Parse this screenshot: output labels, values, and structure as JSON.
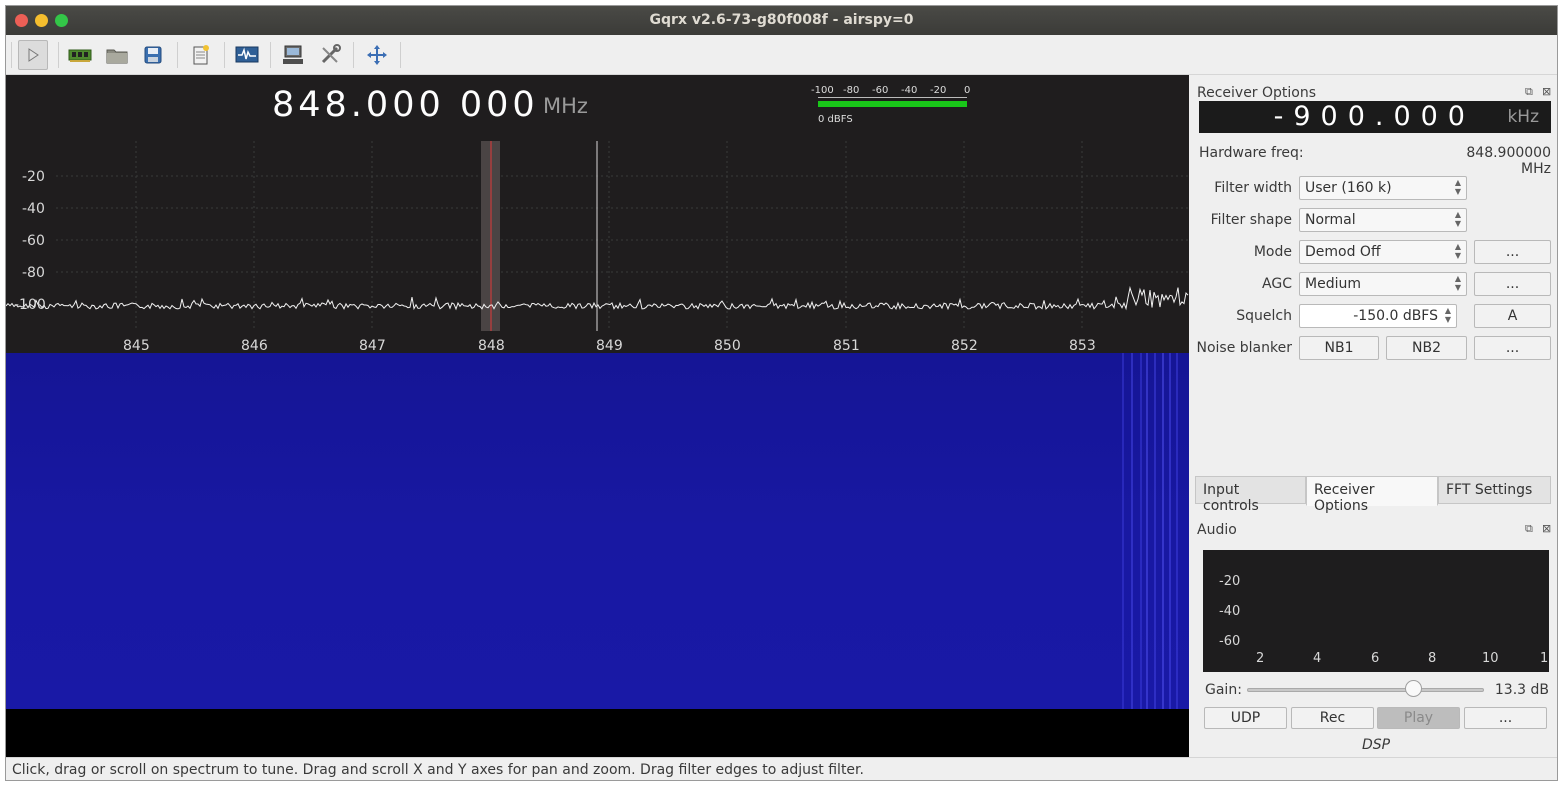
{
  "window": {
    "title": "Gqrx v2.6-73-g80f008f - airspy=0",
    "traffic_lights": [
      "#ec5f56",
      "#f5be2e",
      "#33c648"
    ]
  },
  "toolbar": {
    "icons": [
      "play-icon",
      "hardware-icon",
      "open-folder-icon",
      "save-icon",
      "notes-icon",
      "waveform-icon",
      "network-icon",
      "tools-icon",
      "fullscreen-icon"
    ]
  },
  "main": {
    "frequency": "848.000 000",
    "frequency_unit": "MHz",
    "meter": {
      "ticks": [
        "-100",
        "-80",
        "-60",
        "-40",
        "-20",
        "0"
      ],
      "level_label": "0 dBFS"
    },
    "spectrum": {
      "y_ticks": [
        "-20",
        "-40",
        "-60",
        "-80",
        "-100"
      ],
      "x_ticks": [
        "845",
        "846",
        "847",
        "848",
        "849",
        "850",
        "851",
        "852",
        "853"
      ]
    }
  },
  "receiver": {
    "title": "Receiver Options",
    "offset_value": "-900.000",
    "offset_unit": "kHz",
    "hardware_freq_label": "Hardware freq:",
    "hardware_freq_value": "848.900000 MHz",
    "filter_width_label": "Filter width",
    "filter_width_value": "User (160 k)",
    "filter_shape_label": "Filter shape",
    "filter_shape_value": "Normal",
    "mode_label": "Mode",
    "mode_value": "Demod Off",
    "mode_more": "...",
    "agc_label": "AGC",
    "agc_value": "Medium",
    "agc_more": "...",
    "squelch_label": "Squelch",
    "squelch_value": "-150.0 dBFS",
    "squelch_auto": "A",
    "noise_blanker_label": "Noise blanker",
    "nb1": "NB1",
    "nb2": "NB2",
    "nb_more": "..."
  },
  "tabs": {
    "input_controls": "Input controls",
    "receiver_options": "Receiver Options",
    "fft_settings": "FFT Settings"
  },
  "audio": {
    "title": "Audio",
    "y_ticks": [
      "-20",
      "-40",
      "-60"
    ],
    "x_ticks": [
      "2",
      "4",
      "6",
      "8",
      "10",
      "1"
    ],
    "gain_label": "Gain:",
    "gain_value": "13.3 dB",
    "gain_fraction": 0.7,
    "udp": "UDP",
    "rec": "Rec",
    "play": "Play",
    "more": "...",
    "dsp": "DSP"
  },
  "status": "Click, drag or scroll on spectrum to tune. Drag and scroll X and Y axes for pan and zoom. Drag filter edges to adjust filter."
}
